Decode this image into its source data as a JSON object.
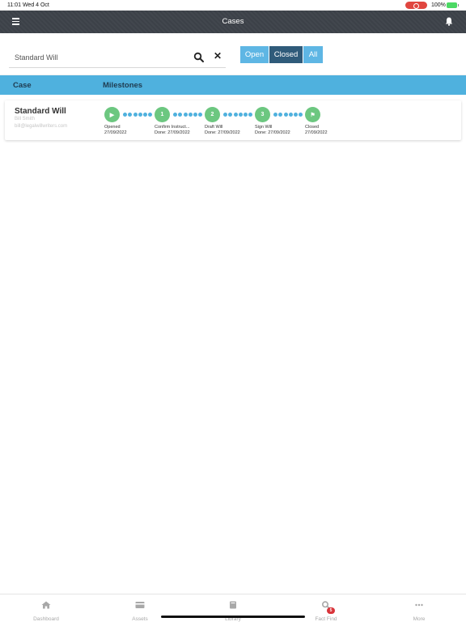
{
  "status_bar": {
    "time": "11:01  Wed 4 Oct",
    "battery": "100%"
  },
  "nav": {
    "title": "Cases"
  },
  "search": {
    "value": "Standard Will",
    "placeholder": ""
  },
  "filters": {
    "open": "Open",
    "closed": "Closed",
    "all": "All",
    "selected": "Closed"
  },
  "table": {
    "col_case": "Case",
    "col_milestones": "Milestones"
  },
  "case": {
    "title": "Standard Will",
    "client": "Bill Smith",
    "email": "bill@legalwillwriters.com"
  },
  "milestones": [
    {
      "icon": "play-icon",
      "symbol": "▶",
      "label": "Opened",
      "date": "27/09/2022"
    },
    {
      "icon": "step-1",
      "symbol": "1",
      "label": "Confirm Instruct...",
      "date": "Done: 27/09/2022"
    },
    {
      "icon": "step-2",
      "symbol": "2",
      "label": "Draft Will",
      "date": "Done: 27/09/2022"
    },
    {
      "icon": "step-3",
      "symbol": "3",
      "label": "Sign Will",
      "date": "Done: 27/09/2022"
    },
    {
      "icon": "flag-icon",
      "symbol": "⚑",
      "label": "Closed",
      "date": "27/09/2022"
    }
  ],
  "tabs": [
    {
      "label": "Dashboard",
      "icon": "home-icon"
    },
    {
      "label": "Assets",
      "icon": "card-icon"
    },
    {
      "label": "Library",
      "icon": "book-icon"
    },
    {
      "label": "Fact Find",
      "icon": "search-icon",
      "badge": "5"
    },
    {
      "label": "More",
      "icon": "more-icon"
    }
  ],
  "colors": {
    "nav": "#3c4148",
    "header": "#4fb1de",
    "milestone": "#6cc780",
    "filter": "#5eb6e4",
    "filter_active": "#2f5b7a",
    "badge": "#d9343a"
  }
}
